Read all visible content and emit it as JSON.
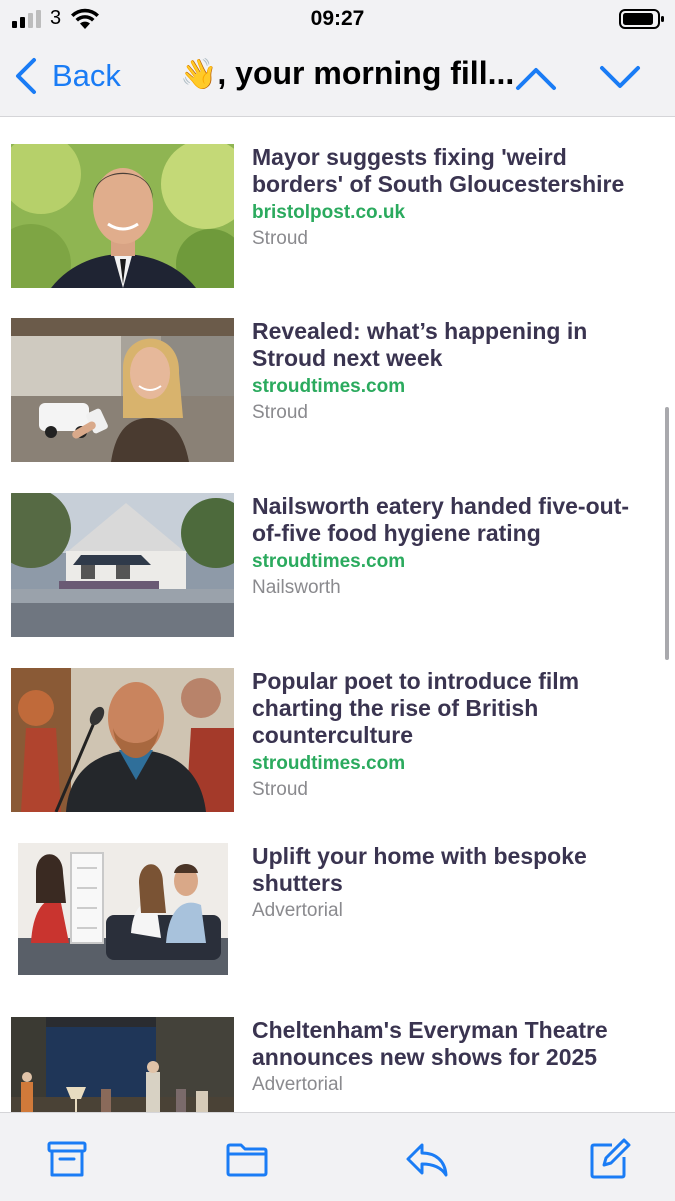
{
  "status_bar": {
    "carrier": "3",
    "time": "09:27"
  },
  "nav": {
    "back_label": "Back",
    "title_emoji": "👋",
    "title": ", your morning fill..."
  },
  "articles": [
    {
      "headline": "Mayor suggests fixing 'weird borders' of South Gloucestershire",
      "source": "bristolpost.co.uk",
      "location": "Stroud"
    },
    {
      "headline": "Revealed: what’s happening in Stroud next week",
      "source": "stroudtimes.com",
      "location": "Stroud"
    },
    {
      "headline": "Nailsworth eatery handed five-out-of-five food hygiene rating",
      "source": "stroudtimes.com",
      "location": "Nailsworth"
    },
    {
      "headline": "Popular poet to introduce film charting the rise of British counterculture",
      "source": "stroudtimes.com",
      "location": "Stroud"
    },
    {
      "headline": "Uplift your home with bespoke shutters",
      "location": "Advertorial"
    },
    {
      "headline": "Cheltenham's Everyman Theatre announces new shows for 2025",
      "location": "Advertorial"
    }
  ],
  "toolbar": {
    "icons": [
      "archive-icon",
      "folder-icon",
      "reply-icon",
      "compose-icon"
    ]
  },
  "colors": {
    "accent": "#1a7cf5",
    "source_green": "#2baa5e",
    "headline": "#3a3450",
    "meta_gray": "#8a8a8e"
  }
}
